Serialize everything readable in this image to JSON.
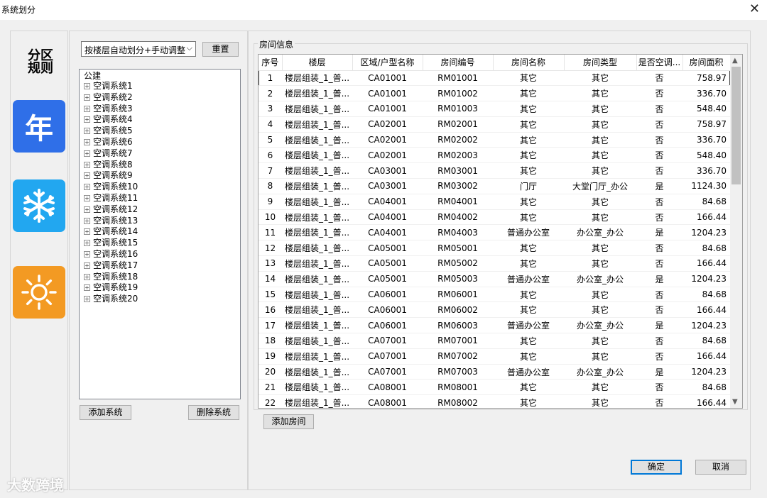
{
  "window": {
    "title": "系统划分",
    "close_glyph": "✕"
  },
  "rail": {
    "rule_label": "分区规则",
    "tiles": [
      {
        "icon": "year-calendar-icon",
        "glyph": "年",
        "color": "#2f6fe8"
      },
      {
        "icon": "snowflake-icon",
        "color": "#22a7f0"
      },
      {
        "icon": "sun-icon",
        "color": "#f39a23"
      }
    ]
  },
  "partition": {
    "mode_value": "按楼层自动划分+手动调整",
    "reset_label": "重置",
    "tree_root": "公建",
    "systems": [
      "空调系统1",
      "空调系统2",
      "空调系统3",
      "空调系统4",
      "空调系统5",
      "空调系统6",
      "空调系统7",
      "空调系统8",
      "空调系统9",
      "空调系统10",
      "空调系统11",
      "空调系统12",
      "空调系统13",
      "空调系统14",
      "空调系统15",
      "空调系统16",
      "空调系统17",
      "空调系统18",
      "空调系统19",
      "空调系统20"
    ],
    "add_system_label": "添加系统",
    "delete_system_label": "删除系统"
  },
  "rooms": {
    "group_title": "房间信息",
    "columns": [
      "序号",
      "楼层",
      "区域/户型名称",
      "房间编号",
      "房间名称",
      "房间类型",
      "是否空调...",
      "房间面积"
    ],
    "rows": [
      [
        "1",
        "楼层组装_1_普...",
        "CA01001",
        "RM01001",
        "其它",
        "其它",
        "否",
        "758.97"
      ],
      [
        "2",
        "楼层组装_1_普...",
        "CA01001",
        "RM01002",
        "其它",
        "其它",
        "否",
        "336.70"
      ],
      [
        "3",
        "楼层组装_1_普...",
        "CA01001",
        "RM01003",
        "其它",
        "其它",
        "否",
        "548.40"
      ],
      [
        "4",
        "楼层组装_1_普...",
        "CA02001",
        "RM02001",
        "其它",
        "其它",
        "否",
        "758.97"
      ],
      [
        "5",
        "楼层组装_1_普...",
        "CA02001",
        "RM02002",
        "其它",
        "其它",
        "否",
        "336.70"
      ],
      [
        "6",
        "楼层组装_1_普...",
        "CA02001",
        "RM02003",
        "其它",
        "其它",
        "否",
        "548.40"
      ],
      [
        "7",
        "楼层组装_1_普...",
        "CA03001",
        "RM03001",
        "其它",
        "其它",
        "否",
        "336.70"
      ],
      [
        "8",
        "楼层组装_1_普...",
        "CA03001",
        "RM03002",
        "门厅",
        "大堂门厅_办公",
        "是",
        "1124.30"
      ],
      [
        "9",
        "楼层组装_1_普...",
        "CA04001",
        "RM04001",
        "其它",
        "其它",
        "否",
        "84.68"
      ],
      [
        "10",
        "楼层组装_1_普...",
        "CA04001",
        "RM04002",
        "其它",
        "其它",
        "否",
        "166.44"
      ],
      [
        "11",
        "楼层组装_1_普...",
        "CA04001",
        "RM04003",
        "普通办公室",
        "办公室_办公",
        "是",
        "1204.23"
      ],
      [
        "12",
        "楼层组装_1_普...",
        "CA05001",
        "RM05001",
        "其它",
        "其它",
        "否",
        "84.68"
      ],
      [
        "13",
        "楼层组装_1_普...",
        "CA05001",
        "RM05002",
        "其它",
        "其它",
        "否",
        "166.44"
      ],
      [
        "14",
        "楼层组装_1_普...",
        "CA05001",
        "RM05003",
        "普通办公室",
        "办公室_办公",
        "是",
        "1204.23"
      ],
      [
        "15",
        "楼层组装_1_普...",
        "CA06001",
        "RM06001",
        "其它",
        "其它",
        "否",
        "84.68"
      ],
      [
        "16",
        "楼层组装_1_普...",
        "CA06001",
        "RM06002",
        "其它",
        "其它",
        "否",
        "166.44"
      ],
      [
        "17",
        "楼层组装_1_普...",
        "CA06001",
        "RM06003",
        "普通办公室",
        "办公室_办公",
        "是",
        "1204.23"
      ],
      [
        "18",
        "楼层组装_1_普...",
        "CA07001",
        "RM07001",
        "其它",
        "其它",
        "否",
        "84.68"
      ],
      [
        "19",
        "楼层组装_1_普...",
        "CA07001",
        "RM07002",
        "其它",
        "其它",
        "否",
        "166.44"
      ],
      [
        "20",
        "楼层组装_1_普...",
        "CA07001",
        "RM07003",
        "普通办公室",
        "办公室_办公",
        "是",
        "1204.23"
      ],
      [
        "21",
        "楼层组装_1_普...",
        "CA08001",
        "RM08001",
        "其它",
        "其它",
        "否",
        "84.68"
      ],
      [
        "22",
        "楼层组装_1_普...",
        "CA08001",
        "RM08002",
        "其它",
        "其它",
        "否",
        "166.44"
      ]
    ],
    "selected_row": 0,
    "add_room_label": "添加房间"
  },
  "footer": {
    "ok_label": "确定",
    "cancel_label": "取消"
  },
  "watermark": "大数跨境"
}
